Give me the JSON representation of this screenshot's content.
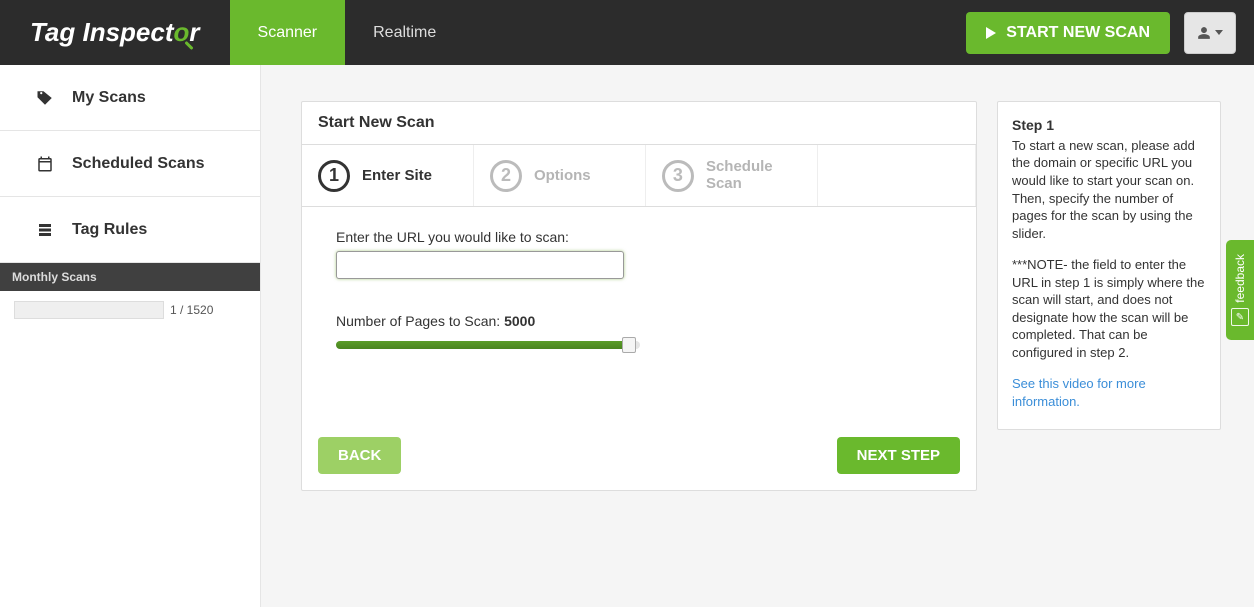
{
  "brand": {
    "part1": "Tag Inspect",
    "o": "o",
    "part2": "r"
  },
  "nav": {
    "scanner": "Scanner",
    "realtime": "Realtime"
  },
  "topbar": {
    "start_new_scan": "START NEW SCAN"
  },
  "sidebar": {
    "my_scans": "My Scans",
    "scheduled_scans": "Scheduled Scans",
    "tag_rules": "Tag Rules",
    "monthly_scans_label": "Monthly Scans",
    "monthly_scans_progress": "1 / 1520"
  },
  "wizard": {
    "title": "Start New Scan",
    "step1_label": "Enter Site",
    "step2_label": "Options",
    "step3_label": "Schedule Scan",
    "url_label": "Enter the URL you would like to scan:",
    "url_value": "",
    "pages_prefix": "Number of Pages to Scan: ",
    "pages_value": "5000",
    "back": "BACK",
    "next": "NEXT STEP"
  },
  "help": {
    "heading": "Step 1",
    "para1": "To start a new scan, please add the domain or specific URL you would like to start your scan on. Then, specify the number of pages for the scan by using the slider.",
    "para2": "***NOTE- the field to enter the URL in step 1 is simply where the scan will start, and does not designate how the scan will be completed. That can be configured in step 2.",
    "link": "See this video for more information."
  },
  "feedback": {
    "label": "feedback"
  }
}
